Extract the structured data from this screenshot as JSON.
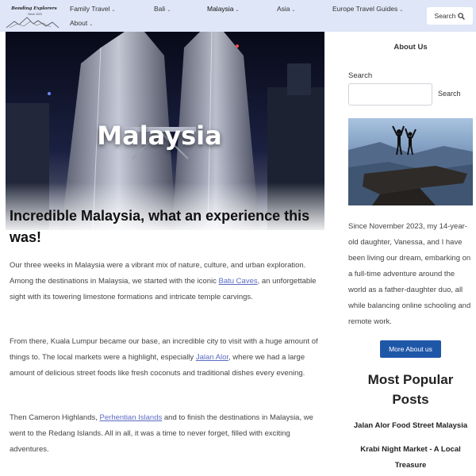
{
  "header": {
    "logo": {
      "title": "Bonding Explorers",
      "tagline": "Since 2023"
    },
    "nav": [
      {
        "label": "Family Travel",
        "has_dropdown": true
      },
      {
        "label": "Bali",
        "has_dropdown": true
      },
      {
        "label": "Malaysia",
        "has_dropdown": true,
        "active": true
      },
      {
        "label": "Asia",
        "has_dropdown": true
      },
      {
        "label": "Europe Travel Guides",
        "has_dropdown": true
      },
      {
        "label": "About",
        "has_dropdown": true
      }
    ],
    "search_label": "Search",
    "search_icon": "search-icon"
  },
  "hero": {
    "title": "Malaysia"
  },
  "article": {
    "title": "Incredible Malaysia, what an experience this was!",
    "paragraphs": [
      {
        "before": "Our three weeks in Malaysia were a vibrant mix of nature, culture, and urban exploration. Among the destinations in Malaysia, we started with the iconic ",
        "link": "Batu Caves",
        "after": ", an unforgettable sight with its towering limestone formations and intricate temple carvings."
      },
      {
        "before": "From there, Kuala Lumpur became our base, an incredible city to visit with a huge amount of things to. The local markets were a highlight, especially ",
        "link": "Jalan Alor",
        "after": ", where we had a large amount of delicious street foods like fresh coconuts and traditional dishes every evening."
      },
      {
        "before": "Then Cameron Highlands, ",
        "link": "Perhentian Islands",
        "after": " and to finish the destinations in Malaysia, we went to the Redang Islands. All in all, it was a time to never forget, filled with exciting adventures."
      }
    ]
  },
  "sidebar": {
    "about_heading": "About Us",
    "search_label": "Search",
    "search_placeholder": "",
    "search_button": "Search",
    "bio": "Since November 2023, my 14-year-old daughter, Vanessa, and I have been living our dream, embarking on a full-time adventure around the world as a father-daughter duo, all while balancing online schooling and remote work.",
    "more_button": "More About us",
    "popular_title": "Most Popular Posts",
    "popular_posts": [
      "Jalan Alor Food Street Malaysia",
      "Krabi Night Market - A Local Treasure"
    ]
  },
  "colors": {
    "header_bg": "#dfe6f7",
    "link": "#5b6bc2",
    "button_blue": "#1f57a8"
  }
}
